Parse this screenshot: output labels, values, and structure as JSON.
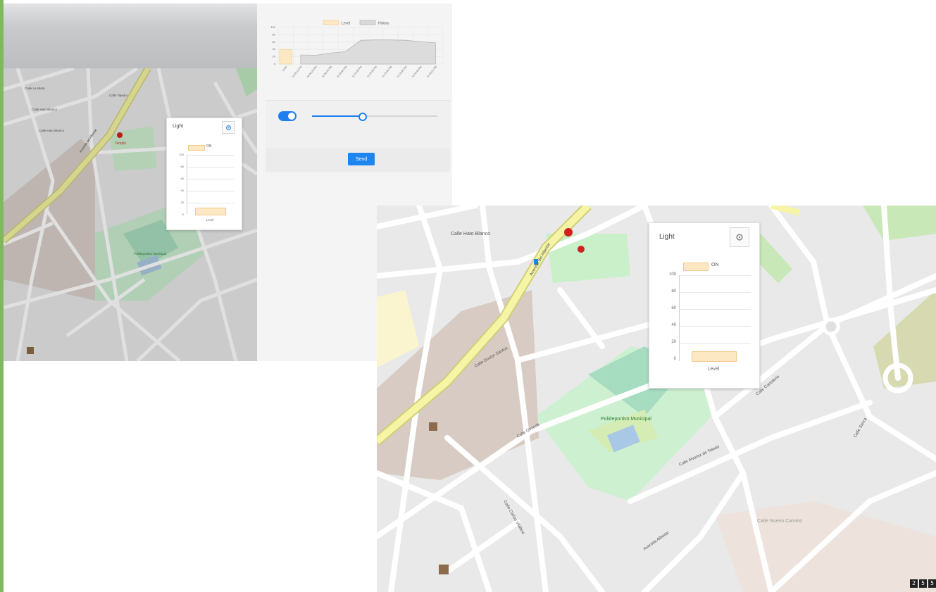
{
  "colors": {
    "accent": "#1d7ff0",
    "bar_fill": "#fde8c4",
    "park": "#c8f0c8",
    "road_primary": "#f7f7a8"
  },
  "shot1": {
    "popup": {
      "title": "Light",
      "legend": "ON",
      "y_ticks": [
        "100",
        "80",
        "60",
        "40",
        "20",
        "0"
      ],
      "x_label": "Level",
      "value": 10
    },
    "side_chart": {
      "legend": [
        "Level",
        "History"
      ],
      "y_ticks": [
        "100",
        "80",
        "60",
        "40",
        "20",
        "0"
      ],
      "x_ticks": [
        "Level",
        "11:25:13 PM",
        "09:36:23 PM",
        "10:36:23 PM",
        "10:39:56 PM",
        "11:15:35 PM",
        "11:19:39 PM",
        "11:15:35 PM",
        "11:15:35 PM",
        "11:33:48 PM",
        "11:43:21 PM"
      ]
    },
    "controls": {
      "toggle_on": true,
      "slider_value": 0.4,
      "send_label": "Send"
    },
    "map_labels": [
      "Calle Hato Blanco",
      "Calle La Isleta",
      "Calle Tejedor",
      "Calle Hato Blanco",
      "Avenida del Albeitar",
      "Polideportivo Municipal",
      "Templo"
    ]
  },
  "shot2": {
    "popup": {
      "title": "Light",
      "legend": "ON",
      "y_ticks": [
        "100",
        "80",
        "60",
        "40",
        "20",
        "0"
      ],
      "x_label": "Level",
      "value": 10
    },
    "map_labels": [
      "Calle Hato Blanco",
      "Avenida del Albeitar",
      "Calle Doctor Santos",
      "Polideportivo Municipal",
      "Calle Olmeda",
      "Calle Carlos Vilaboa",
      "Calle Alvarez de Toledo",
      "Avenida Albeitar",
      "Calle Sierra",
      "Calle Cantabria",
      "Calle Nuevo Camino"
    ],
    "scale_badge": [
      "2",
      "5",
      "5"
    ]
  },
  "chart_data": [
    {
      "type": "bar",
      "title": "Light",
      "categories": [
        "Level"
      ],
      "series": [
        {
          "name": "ON",
          "values": [
            10
          ]
        }
      ],
      "ylim": [
        0,
        100
      ]
    },
    {
      "type": "line",
      "x": [
        "Level",
        "11:25:13 PM",
        "09:36:23 PM",
        "10:36:23 PM",
        "10:39:56 PM",
        "11:15:35 PM",
        "11:19:39 PM",
        "11:15:35 PM",
        "11:15:35 PM",
        "11:33:48 PM",
        "11:43:21 PM"
      ],
      "series": [
        {
          "name": "Level",
          "values": [
            40,
            null,
            null,
            null,
            null,
            null,
            null,
            null,
            null,
            null,
            null
          ]
        },
        {
          "name": "History",
          "values": [
            null,
            25,
            24,
            30,
            34,
            65,
            66,
            66,
            65,
            61,
            58
          ]
        }
      ],
      "ylim": [
        0,
        100
      ]
    }
  ]
}
